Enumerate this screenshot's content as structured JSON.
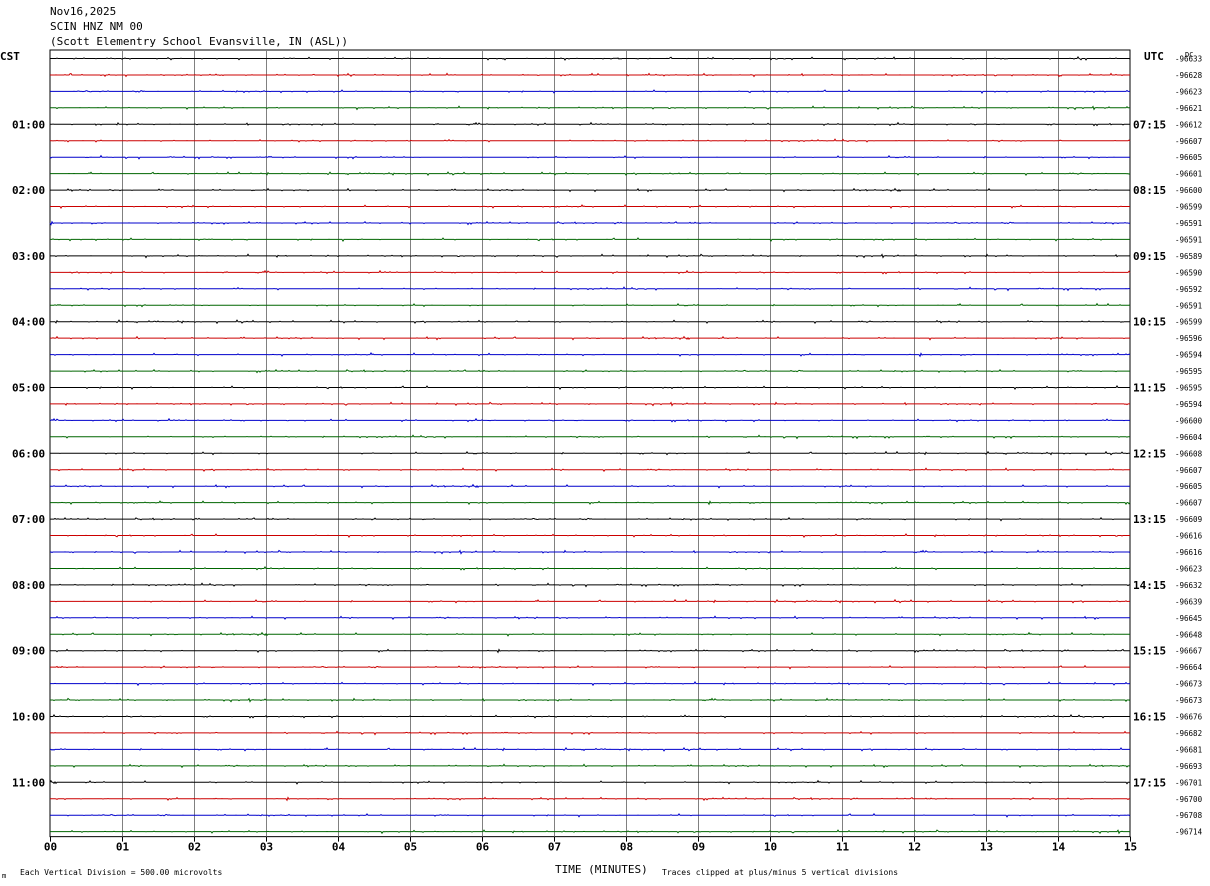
{
  "header": {
    "date": "Nov16,2025",
    "station": "SCIN HNZ NM 00",
    "location": "(Scott Elementry School Evansville, IN (ASL))"
  },
  "labels": {
    "left_tz": "CST",
    "right_tz": "UTC",
    "dc": "DC"
  },
  "footer": {
    "scale_note": "Each Vertical Division =  500.00 microvolts",
    "xlabel": "TIME (MINUTES)",
    "clip_note": "Traces clipped at plus/minus 5 vertical divisions",
    "corner_mark": "m"
  },
  "chart_data": {
    "type": "line",
    "xlabel": "TIME (MINUTES)",
    "xlim": [
      0,
      15
    ],
    "x_ticks": [
      "00",
      "01",
      "02",
      "03",
      "04",
      "05",
      "06",
      "07",
      "08",
      "09",
      "10",
      "11",
      "12",
      "13",
      "14",
      "15"
    ],
    "trace_minutes": 15,
    "trace_colors": [
      "#000000",
      "#cc0000",
      "#0000cc",
      "#006600"
    ],
    "gridline_color": "#808080",
    "hour_labels_local": [
      "01:00",
      "02:00",
      "03:00",
      "04:00",
      "05:00",
      "06:00",
      "07:00",
      "08:00",
      "09:00",
      "10:00",
      "11:00"
    ],
    "hour_labels_utc": [
      "07:15",
      "08:15",
      "09:15",
      "10:15",
      "11:15",
      "12:15",
      "13:15",
      "14:15",
      "15:15",
      "16:15",
      "17:15"
    ],
    "dc_offsets": [
      "-96633",
      "-96628",
      "-96623",
      "-96621",
      "-96612",
      "-96607",
      "-96605",
      "-96601",
      "-96600",
      "-96599",
      "-96591",
      "-96591",
      "-96589",
      "-96590",
      "-96592",
      "-96591",
      "-96599",
      "-96596",
      "-96594",
      "-96595",
      "-96595",
      "-96594",
      "-96600",
      "-96604",
      "-96608",
      "-96607",
      "-96605",
      "-96607",
      "-96609",
      "-96616",
      "-96616",
      "-96623",
      "-96632",
      "-96639",
      "-96645",
      "-96648",
      "-96667",
      "-96664",
      "-96673",
      "-96673",
      "-96676",
      "-96682",
      "-96681",
      "-96693",
      "-96701",
      "-96700",
      "-96708",
      "-96714"
    ]
  }
}
